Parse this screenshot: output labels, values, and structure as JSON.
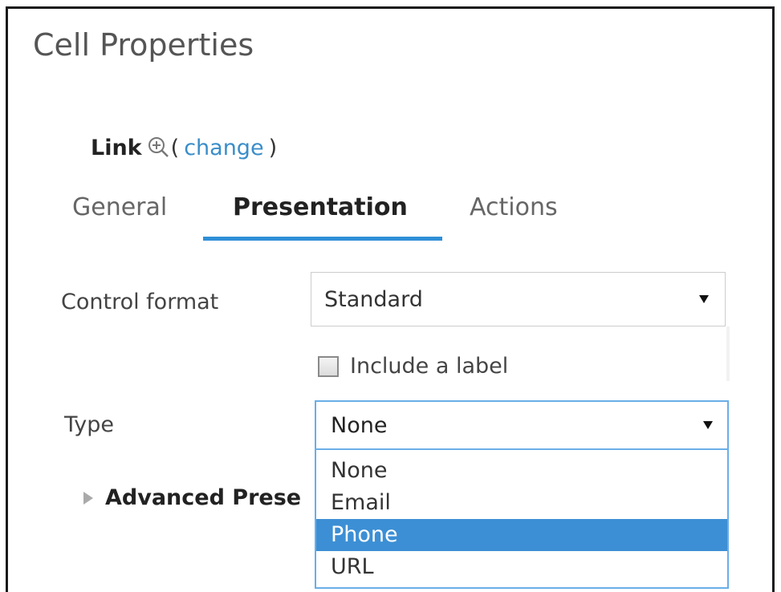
{
  "panel": {
    "title": "Cell Properties"
  },
  "link": {
    "label": "Link",
    "icon": "zoom-in-icon",
    "open_paren": "(",
    "change_label": "change",
    "close_paren": ")"
  },
  "tabs": [
    {
      "label": "General",
      "active": false
    },
    {
      "label": "Presentation",
      "active": true
    },
    {
      "label": "Actions",
      "active": false
    }
  ],
  "control_format": {
    "label": "Control format",
    "value": "Standard"
  },
  "include_label": {
    "label": "Include a label",
    "checked": false
  },
  "type": {
    "label": "Type",
    "value": "None",
    "options": [
      "None",
      "Email",
      "Phone",
      "URL"
    ],
    "highlighted": "Phone"
  },
  "advanced": {
    "label": "Advanced Prese"
  },
  "colors": {
    "accent": "#2f8fd6",
    "link": "#3a8dc9",
    "highlight": "#3c8fd4"
  }
}
